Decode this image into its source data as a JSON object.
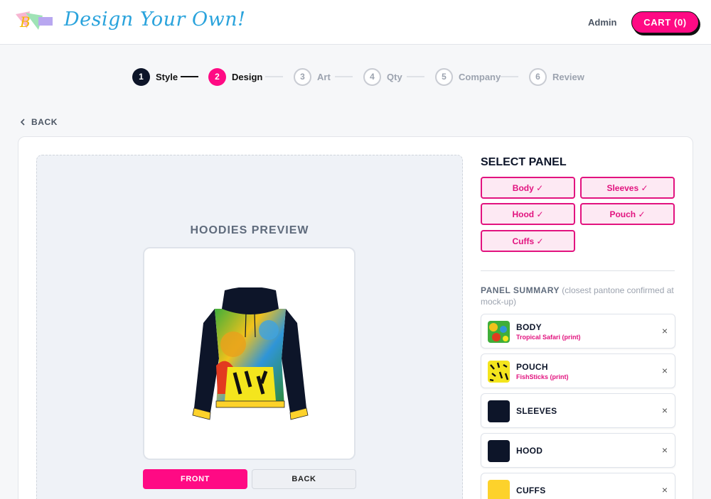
{
  "header": {
    "brand": "Design Your Own!",
    "admin": "Admin",
    "cart": "CART (0)"
  },
  "steps": [
    {
      "num": "1",
      "label": "Style",
      "state": "done"
    },
    {
      "num": "2",
      "label": "Design",
      "state": "active"
    },
    {
      "num": "3",
      "label": "Art",
      "state": "todo"
    },
    {
      "num": "4",
      "label": "Qty",
      "state": "todo"
    },
    {
      "num": "5",
      "label": "Company",
      "state": "todo"
    },
    {
      "num": "6",
      "label": "Review",
      "state": "todo"
    }
  ],
  "nav": {
    "back": "BACK"
  },
  "preview": {
    "title": "HOODIES PREVIEW",
    "front": "FRONT",
    "back": "BACK"
  },
  "select_panel": {
    "title": "SELECT PANEL",
    "buttons": [
      "Body ✓",
      "Sleeves ✓",
      "Hood ✓",
      "Pouch ✓",
      "Cuffs ✓"
    ]
  },
  "summary": {
    "title": "PANEL SUMMARY",
    "note": "(closest pantone confirmed at mock-up)",
    "items": [
      {
        "name": "BODY",
        "sub": "Tropical Safari (print)",
        "swatch": "print-tropical"
      },
      {
        "name": "POUCH",
        "sub": "FishSticks (print)",
        "swatch": "print-fishsticks"
      },
      {
        "name": "SLEEVES",
        "sub": "",
        "swatch": "#0d1529"
      },
      {
        "name": "HOOD",
        "sub": "",
        "swatch": "#0d1529"
      },
      {
        "name": "CUFFS",
        "sub": "",
        "swatch": "#fdd22b"
      }
    ],
    "remove_symbol": "×"
  },
  "colors": {
    "accent": "#ff0a84",
    "navy": "#0d1529",
    "brand_blue": "#2aa3dc",
    "cuff_yellow": "#fdd22b"
  }
}
